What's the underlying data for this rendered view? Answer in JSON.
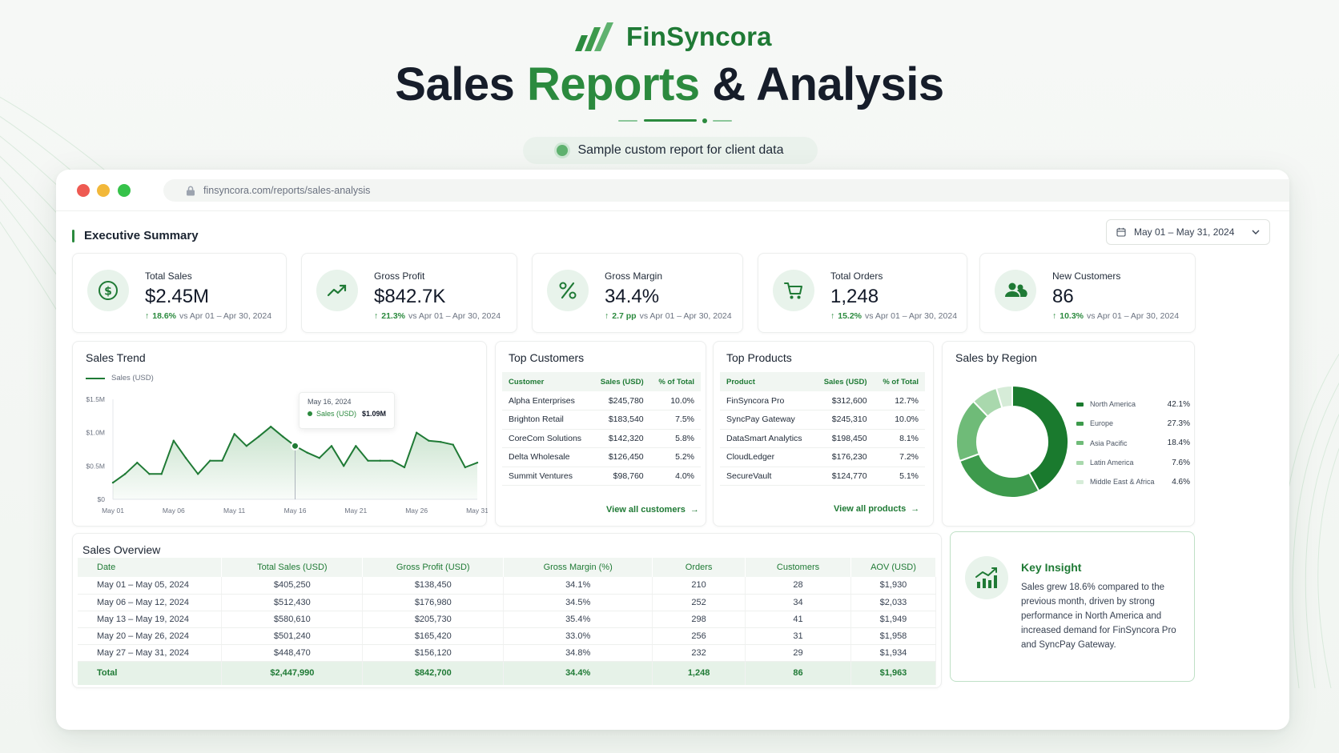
{
  "brand": {
    "name": "FinSyncora"
  },
  "hero": {
    "title_part1": "Sales ",
    "title_accent": "Reports",
    "title_part2": " & Analysis",
    "subtitle": "Sample custom report for client data"
  },
  "browser": {
    "url": "finsyncora.com/reports/sales-analysis"
  },
  "summary": {
    "heading": "Executive Summary",
    "date_range": "May 01 – May 31, 2024"
  },
  "kpis": [
    {
      "label": "Total Sales",
      "value": "$2.45M",
      "delta": "18.6%",
      "compare": "vs Apr 01 – Apr 30, 2024",
      "icon": "dollar-circle-icon"
    },
    {
      "label": "Gross Profit",
      "value": "$842.7K",
      "delta": "21.3%",
      "compare": "vs Apr 01 – Apr 30, 2024",
      "icon": "trend-up-icon"
    },
    {
      "label": "Gross Margin",
      "value": "34.4%",
      "delta": "2.7 pp",
      "compare": "vs Apr 01 – Apr 30, 2024",
      "icon": "percent-icon"
    },
    {
      "label": "Total Orders",
      "value": "1,248",
      "delta": "15.2%",
      "compare": "vs Apr 01 – Apr 30, 2024",
      "icon": "cart-icon"
    },
    {
      "label": "New Customers",
      "value": "86",
      "delta": "10.3%",
      "compare": "vs Apr 01 – Apr 30, 2024",
      "icon": "users-icon"
    }
  ],
  "sales_trend": {
    "title": "Sales Trend",
    "tooltip": {
      "date": "May 16, 2024",
      "series": "Sales (USD)",
      "value": "$1.09M"
    }
  },
  "chart_data": {
    "type": "area",
    "title": "Sales Trend",
    "series": [
      {
        "name": "Sales (USD)",
        "values": [
          0.25,
          0.38,
          0.55,
          0.38,
          0.38,
          0.88,
          0.62,
          0.38,
          0.58,
          0.58,
          0.98,
          0.8,
          0.94,
          1.09,
          0.94,
          0.8,
          0.7,
          0.62,
          0.8,
          0.5,
          0.8,
          0.58,
          0.58,
          0.58,
          0.48,
          1.0,
          0.88,
          0.86,
          0.82,
          0.48,
          0.55
        ]
      }
    ],
    "x": [
      "May 01",
      "May 02",
      "May 03",
      "May 04",
      "May 05",
      "May 06",
      "May 07",
      "May 08",
      "May 09",
      "May 10",
      "May 11",
      "May 12",
      "May 13",
      "May 14",
      "May 15",
      "May 16",
      "May 17",
      "May 18",
      "May 19",
      "May 20",
      "May 21",
      "May 22",
      "May 23",
      "May 24",
      "May 25",
      "May 26",
      "May 27",
      "May 28",
      "May 29",
      "May 30",
      "May 31"
    ],
    "x_ticks": [
      "May 01",
      "May 06",
      "May 11",
      "May 16",
      "May 21",
      "May 26",
      "May 31"
    ],
    "y_ticks": [
      "$0",
      "$0.5M",
      "$1.0M",
      "$1.5M"
    ],
    "y_unit": "M USD",
    "ylim": [
      0,
      1.5
    ],
    "grid": false,
    "legend": "top-left"
  },
  "top_customers": {
    "title": "Top Customers",
    "headers": [
      "Customer",
      "Sales (USD)",
      "% of Total"
    ],
    "rows": [
      [
        "Alpha Enterprises",
        "$245,780",
        "10.0%"
      ],
      [
        "Brighton Retail",
        "$183,540",
        "7.5%"
      ],
      [
        "CoreCom Solutions",
        "$142,320",
        "5.8%"
      ],
      [
        "Delta Wholesale",
        "$126,450",
        "5.2%"
      ],
      [
        "Summit Ventures",
        "$98,760",
        "4.0%"
      ]
    ],
    "link": "View all customers"
  },
  "top_products": {
    "title": "Top Products",
    "headers": [
      "Product",
      "Sales (USD)",
      "% of Total"
    ],
    "rows": [
      [
        "FinSyncora Pro",
        "$312,600",
        "12.7%"
      ],
      [
        "SyncPay Gateway",
        "$245,310",
        "10.0%"
      ],
      [
        "DataSmart Analytics",
        "$198,450",
        "8.1%"
      ],
      [
        "CloudLedger",
        "$176,230",
        "7.2%"
      ],
      [
        "SecureVault",
        "$124,770",
        "5.1%"
      ]
    ],
    "link": "View all products"
  },
  "sales_by_region": {
    "title": "Sales by Region",
    "regions": [
      {
        "name": "North America",
        "pct": "42.1%",
        "value": 42.1,
        "color": "#1a7a2e"
      },
      {
        "name": "Europe",
        "pct": "27.3%",
        "value": 27.3,
        "color": "#3d9a4c"
      },
      {
        "name": "Asia Pacific",
        "pct": "18.4%",
        "value": 18.4,
        "color": "#6fbb78"
      },
      {
        "name": "Latin America",
        "pct": "7.6%",
        "value": 7.6,
        "color": "#a9d8ad"
      },
      {
        "name": "Middle East & Africa",
        "pct": "4.6%",
        "value": 4.6,
        "color": "#d6ecd8"
      }
    ]
  },
  "sales_overview": {
    "title": "Sales Overview",
    "headers": [
      "Date",
      "Total Sales (USD)",
      "Gross Profit (USD)",
      "Gross Margin (%)",
      "Orders",
      "Customers",
      "AOV (USD)"
    ],
    "rows": [
      [
        "May 01 – May 05, 2024",
        "$405,250",
        "$138,450",
        "34.1%",
        "210",
        "28",
        "$1,930"
      ],
      [
        "May 06 – May 12, 2024",
        "$512,430",
        "$176,980",
        "34.5%",
        "252",
        "34",
        "$2,033"
      ],
      [
        "May 13 – May 19, 2024",
        "$580,610",
        "$205,730",
        "35.4%",
        "298",
        "41",
        "$1,949"
      ],
      [
        "May 20 – May 26, 2024",
        "$501,240",
        "$165,420",
        "33.0%",
        "256",
        "31",
        "$1,958"
      ],
      [
        "May 27 – May 31, 2024",
        "$448,470",
        "$156,120",
        "34.8%",
        "232",
        "29",
        "$1,934"
      ]
    ],
    "total": [
      "Total",
      "$2,447,990",
      "$842,700",
      "34.4%",
      "1,248",
      "86",
      "$1,963"
    ]
  },
  "insight": {
    "title": "Key Insight",
    "body": "Sales grew 18.6% compared to the previous month, driven by strong performance in North America and increased demand for FinSyncora Pro and SyncPay Gateway."
  },
  "colors": {
    "brand": "#1f7a35",
    "accent": "#2b8a3e",
    "light": "#e8f3eb"
  }
}
